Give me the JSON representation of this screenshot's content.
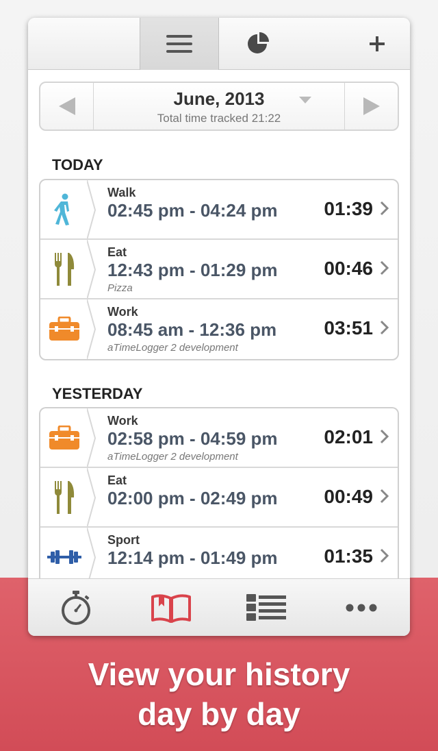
{
  "toolbar": {
    "tabs": [
      {
        "name": "list",
        "icon": "list-icon"
      },
      {
        "name": "chart",
        "icon": "pie-chart-icon"
      },
      {
        "name": "add",
        "icon": "plus-icon"
      }
    ],
    "add_label": "+"
  },
  "month_nav": {
    "title": "June, 2013",
    "subtitle": "Total time tracked 21:22"
  },
  "sections": [
    {
      "title": "TODAY",
      "entries": [
        {
          "category": "Walk",
          "range": "02:45 pm - 04:24 pm",
          "note": "",
          "duration": "01:39",
          "icon": "walk-icon"
        },
        {
          "category": "Eat",
          "range": "12:43 pm - 01:29 pm",
          "note": "Pizza",
          "duration": "00:46",
          "icon": "fork-knife-icon"
        },
        {
          "category": "Work",
          "range": "08:45 am - 12:36 pm",
          "note": "aTimeLogger 2 development",
          "duration": "03:51",
          "icon": "toolbox-icon"
        }
      ]
    },
    {
      "title": "YESTERDAY",
      "entries": [
        {
          "category": "Work",
          "range": "02:58 pm - 04:59 pm",
          "note": "aTimeLogger 2 development",
          "duration": "02:01",
          "icon": "toolbox-icon"
        },
        {
          "category": "Eat",
          "range": "02:00 pm - 02:49 pm",
          "note": "",
          "duration": "00:49",
          "icon": "fork-knife-icon"
        },
        {
          "category": "Sport",
          "range": "12:14 pm - 01:49 pm",
          "note": "",
          "duration": "01:35",
          "icon": "dumbbell-icon"
        }
      ]
    }
  ],
  "bottom_tabs": [
    {
      "name": "timer",
      "icon": "stopwatch-icon",
      "active": false
    },
    {
      "name": "history",
      "icon": "book-icon",
      "active": true
    },
    {
      "name": "categories",
      "icon": "list-grid-icon",
      "active": false
    },
    {
      "name": "more",
      "icon": "more-dots-icon",
      "active": false
    }
  ],
  "promo": {
    "line1": "View your history",
    "line2": "day by day"
  },
  "colors": {
    "accent": "#d9434b",
    "banner": "#d6545e",
    "walk": "#4fb6d8",
    "eat": "#8f8a3a",
    "work": "#f08a2a",
    "sport": "#2f5ea8"
  }
}
